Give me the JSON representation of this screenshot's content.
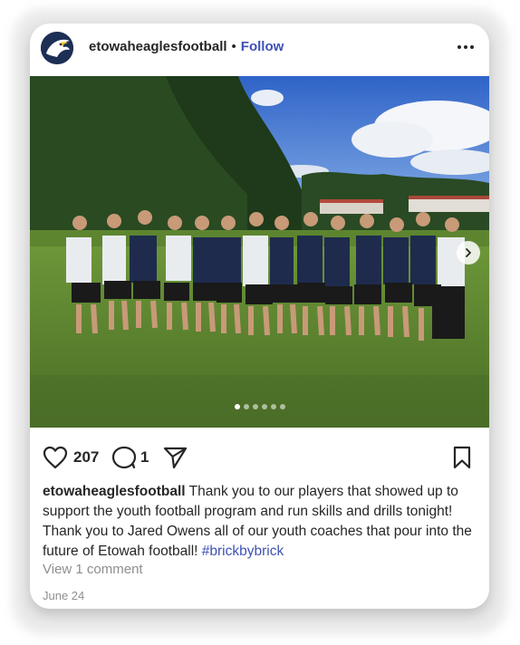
{
  "post": {
    "username": "etowaheaglesfootball",
    "separator": "•",
    "follow_label": "Follow",
    "likes": "207",
    "comments_count": "1",
    "caption_user": "etowaheaglesfootball",
    "caption_text": " Thank you to our players that showed up to support the youth football program and run skills and drills tonight! Thank you to Jared Owens all of our youth coaches that pour into the future of Etowah football! ",
    "hashtag": "#brickbybrick",
    "view_comments": "View 1 comment",
    "date": "June 24",
    "carousel": {
      "total": 6,
      "active": 1
    }
  },
  "icons": {
    "more": "more-horizontal-icon",
    "like": "heart-icon",
    "comment": "comment-bubble-icon",
    "share": "paper-plane-icon",
    "save": "bookmark-icon",
    "next": "chevron-right-icon"
  },
  "colors": {
    "accent": "#3f51b5",
    "text": "#262626",
    "muted": "#8e8e8e"
  }
}
